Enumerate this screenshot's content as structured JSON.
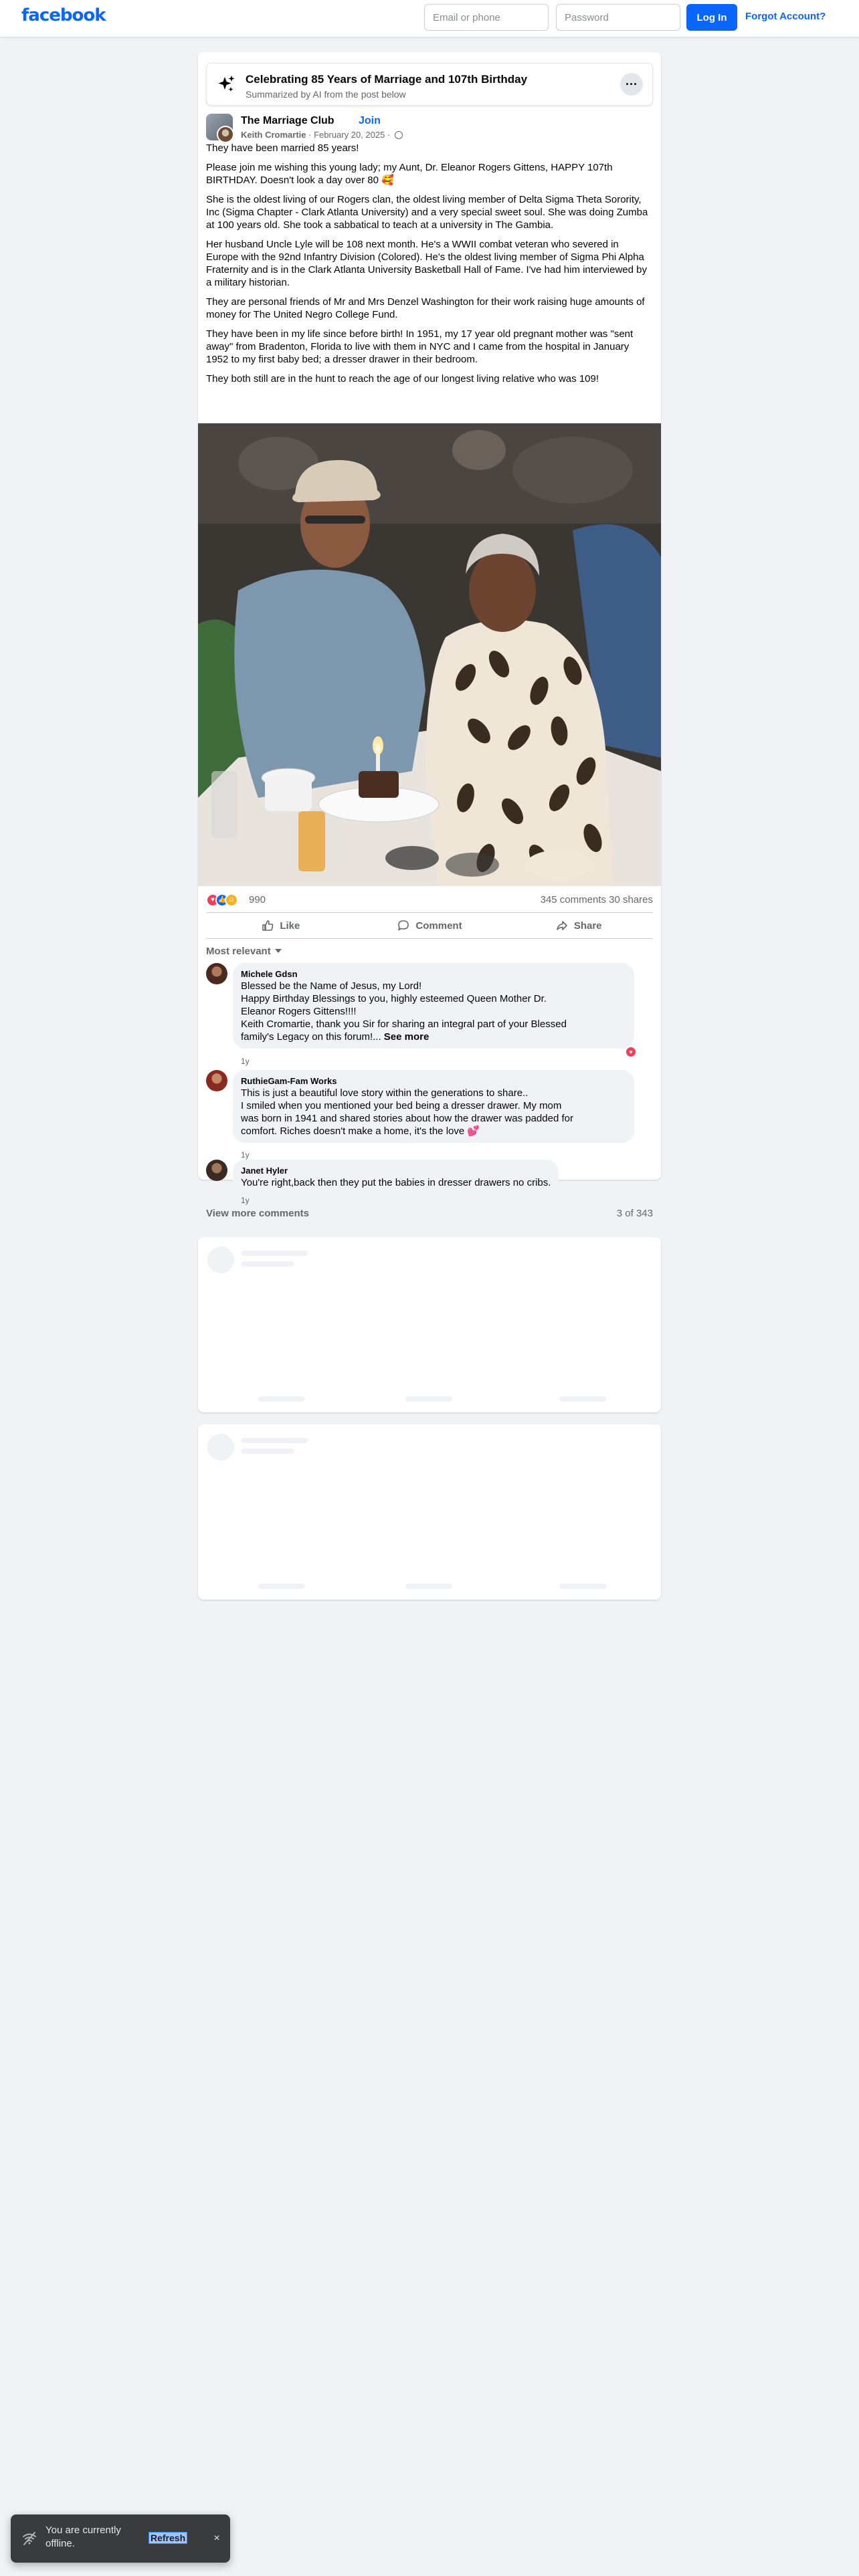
{
  "header": {
    "logo": "facebook",
    "email_placeholder": "Email or phone",
    "password_placeholder": "Password",
    "login_label": "Log In",
    "forgot_label": "Forgot Account?"
  },
  "ai_summary": {
    "title": "Celebrating 85 Years of Marriage and 107th Birthday",
    "subtitle": "Summarized by AI from the post below",
    "more_label": "···"
  },
  "post": {
    "group": "The Marriage Club",
    "join_label": "Join",
    "author": "Keith Cromartie",
    "date": " · February 20, 2025 · ",
    "paragraphs": [
      "They have been married 85 years!",
      "Please join me wishing this young lady; my Aunt, Dr. Eleanor Rogers Gittens, HAPPY 107th BIRTHDAY.  Doesn't look a day over 80 🥰",
      "She is the oldest living of our Rogers clan,  the oldest living member of Delta Sigma Theta Sorority, Inc (Sigma Chapter - Clark Atlanta University) and a very special sweet soul.   She was doing Zumba at 100 years old. She took a sabbatical to teach at a university in The Gambia.",
      "Her husband Uncle Lyle will be 108 next month.  He's a WWII combat veteran who severed in Europe with the 92nd Infantry Division (Colored).  He's the oldest living member of Sigma Phi Alpha Fraternity and is in the Clark Atlanta University Basketball Hall of Fame.  I've had him interviewed by a military historian.",
      "They are personal friends of Mr and Mrs Denzel Washington for their work raising huge amounts of money for The United Negro College Fund.",
      "They have been in my life since before birth!  In 1951, my 17 year old pregnant mother was \"sent away\" from Bradenton, Florida to live with them in NYC and I came from the hospital in January 1952 to my first baby bed; a dresser drawer in their bedroom.",
      "They both still are in the hunt to reach the age of our longest living relative who was 109!"
    ],
    "reaction_count": "990",
    "comments_shares": "345 comments   30 shares",
    "actions": {
      "like": "Like",
      "comment": "Comment",
      "share": "Share"
    },
    "sort_label": "Most relevant"
  },
  "comments": [
    {
      "name": "Michele Gdsn",
      "lines": [
        "Blessed be the Name of Jesus, my Lord!",
        "Happy Birthday Blessings to you, highly esteemed Queen Mother Dr.",
        "Eleanor Rogers Gittens!!!!",
        "Keith Cromartie, thank you Sir for sharing an integral part of your Blessed",
        "family's Legacy on this forum!..."
      ],
      "see_more": "See more",
      "time": "1y"
    },
    {
      "name": "RuthieGam-Fam Works",
      "lines": [
        "This is just a beautiful love story within the generations to share..",
        "I smiled when you mentioned your bed being a dresser drawer. My mom",
        "was born in 1941 and shared stories about how the drawer was padded for",
        "comfort. Riches doesn't make a home, it's the love 💕"
      ],
      "time": "1y"
    },
    {
      "name": "Janet Hyler",
      "lines": [
        "You're right,back then they put the babies in dresser drawers no cribs."
      ],
      "time": "1y"
    }
  ],
  "view_more": {
    "label": "View more comments",
    "count": "3 of 343"
  },
  "toast": {
    "text": "You are currently offline.",
    "refresh": "Refresh",
    "close": "×"
  }
}
